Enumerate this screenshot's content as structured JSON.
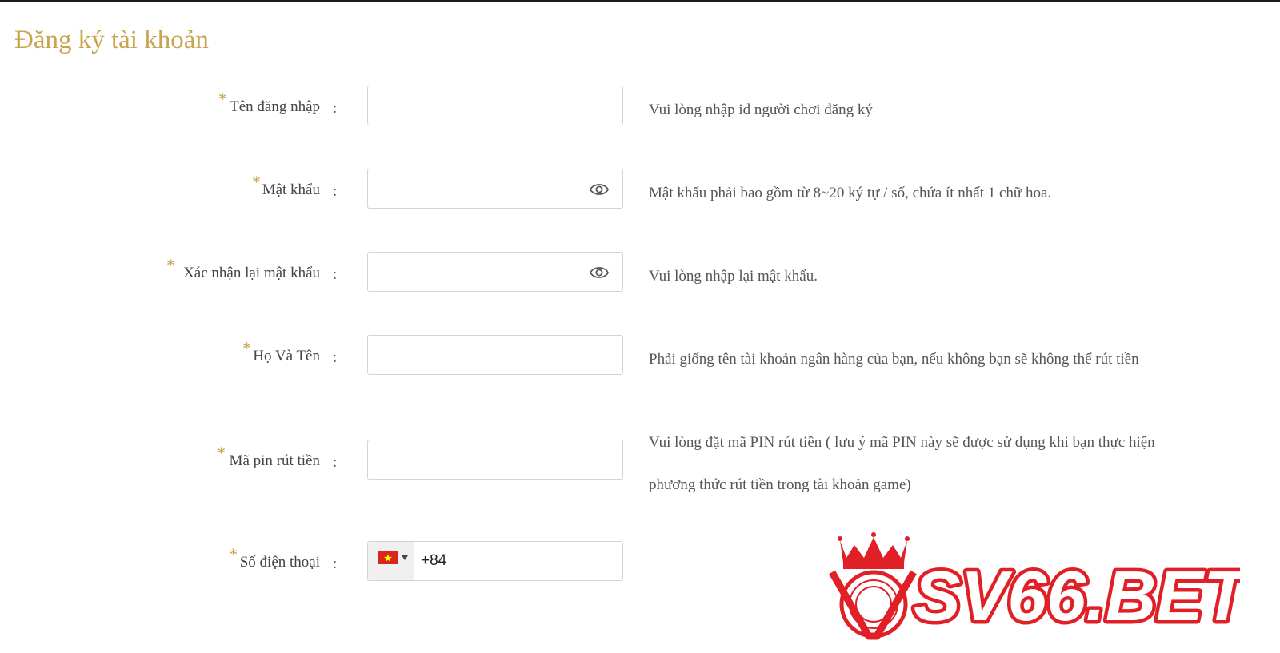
{
  "page": {
    "title": "Đăng ký tài khoản"
  },
  "form": {
    "required_mark": "*",
    "separator": ":",
    "fields": [
      {
        "label": "Tên đăng nhập",
        "value": "",
        "hint_lines": [
          "Vui lòng nhập id người chơi đăng ký"
        ]
      },
      {
        "label": "Mật khẩu",
        "value": "",
        "hint_lines": [
          "Mật khẩu phải bao gồm từ 8~20 ký tự / số, chứa ít nhất 1 chữ hoa."
        ]
      },
      {
        "label": "Xác nhận lại mật khẩu",
        "value": "",
        "hint_lines": [
          "Vui lòng nhập lại mật khẩu."
        ]
      },
      {
        "label": "Họ Và Tên",
        "value": "",
        "hint_lines": [
          "Phải giống tên tài khoản ngân hàng của bạn, nếu không bạn sẽ không thể rút tiền"
        ]
      },
      {
        "label": "Mã pin rút tiền",
        "value": "",
        "hint_lines": [
          "Vui lòng đặt mã PIN rút tiền ( lưu ý mã PIN này sẽ được sử dụng khi bạn thực hiện",
          "phương thức rút tiền trong tài khoản game)"
        ]
      },
      {
        "label": "Số điện thoại",
        "value": "+84",
        "hint_lines": []
      }
    ]
  },
  "icons": {
    "password_toggle": "eye-icon",
    "country_flag": "vietnam-flag-icon",
    "dropdown": "caret-down-icon"
  },
  "brand": {
    "name": "SV66.BET",
    "color": "#e01f26",
    "logo_monogram": "V"
  },
  "colors": {
    "accent": "#c9a44c",
    "border": "#d4d4d4",
    "text": "#444444"
  }
}
